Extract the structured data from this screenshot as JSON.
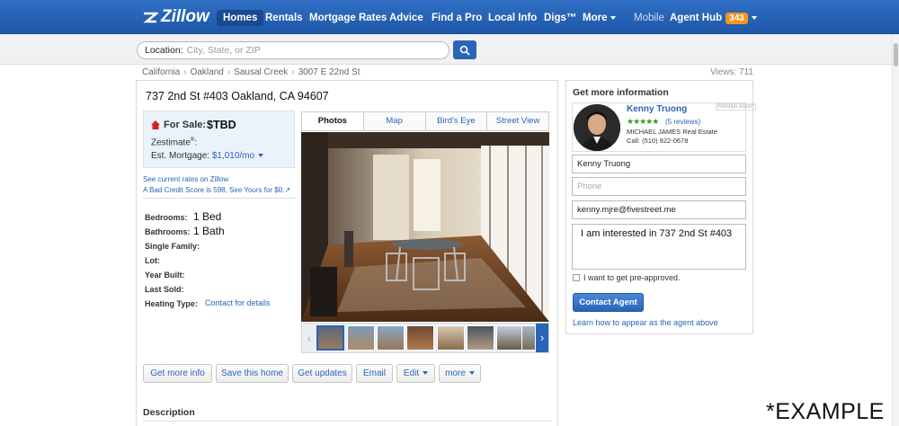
{
  "nav": {
    "logo": "Zillow",
    "items": [
      {
        "label": "Homes"
      },
      {
        "label": "Rentals"
      },
      {
        "label": "Mortgage Rates"
      },
      {
        "label": "Advice"
      },
      {
        "label": "Find a Pro"
      },
      {
        "label": "Local Info"
      },
      {
        "label": "Digs™"
      },
      {
        "label": "More"
      }
    ],
    "mobile": "Mobile",
    "agent_hub": "Agent Hub",
    "agent_hub_count": "343"
  },
  "search": {
    "label": "Location:",
    "placeholder": "City, State, or ZIP"
  },
  "breadcrumb": [
    "California",
    "Oakland",
    "Sausal Creek",
    "3007 E 22nd St"
  ],
  "views": "Views: 711",
  "listing": {
    "address": "737 2nd St #403 Oakland, CA 94607",
    "for_sale_label": "For Sale:",
    "price": "$TBD",
    "zestimate": "Zestimate",
    "zestimate_mark": "®",
    "zestimate_suffix": ":",
    "mortgage_label": "Est. Mortgage:",
    "mortgage_value": "$1,010/mo",
    "rates_link": "See current rates on Zillow",
    "credit_link": "A Bad Credit Score is 598, See Yours for $0.",
    "facts": {
      "bedrooms_label": "Bedrooms:",
      "bedrooms_value": "1 Bed",
      "bathrooms_label": "Bathrooms:",
      "bathrooms_value": "1 Bath",
      "single_family": "Single Family:",
      "lot": "Lot:",
      "year_built": "Year Built:",
      "last_sold": "Last Sold:",
      "heating_type": "Heating Type:",
      "heating_link": "Contact for details"
    }
  },
  "photo_tabs": [
    "Photos",
    "Map",
    "Bird's Eye",
    "Street View"
  ],
  "actions": {
    "get_more_info": "Get more info",
    "save": "Save this home",
    "updates": "Get updates",
    "email": "Email",
    "edit": "Edit",
    "more": "more"
  },
  "description_heading": "Description",
  "sidebar": {
    "title": "Get more information",
    "agent_name": "Kenny Truong",
    "premier": "PREMIER AGENT",
    "stars": "★★★★★",
    "reviews": "(5 reviews)",
    "agency": "MICHAEL JAMES Real Estate",
    "phone": "Call: (510) 922-0678",
    "name_value": "Kenny Truong",
    "phone_placeholder": "Phone",
    "email_value": "kenny.mjre@fivestreet.me",
    "message": "I am interested in 737 2nd St #403",
    "preapproved_label": "I want to get pre-approved.",
    "contact_button": "Contact Agent",
    "learn_link": "Learn how to appear as the agent above"
  },
  "watermark": "*EXAMPLE",
  "colors": {
    "brand_blue": "#2a64b8",
    "nav_blue": "#2f6fc4",
    "badge_orange": "#f7931e",
    "star_green": "#3a9b2b"
  }
}
